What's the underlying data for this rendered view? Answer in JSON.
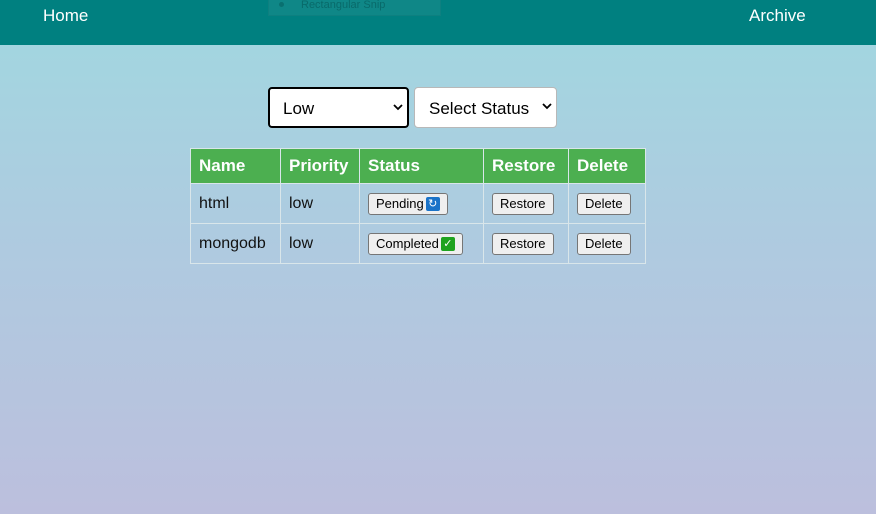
{
  "nav": {
    "home_label": "Home",
    "archive_label": "Archive"
  },
  "overlay": {
    "snip_label": "Rectangular Snip"
  },
  "filters": {
    "priority_selected": "Low",
    "status_selected": "Select Status"
  },
  "table": {
    "headers": {
      "name": "Name",
      "priority": "Priority",
      "status": "Status",
      "restore": "Restore",
      "delete": "Delete"
    },
    "rows": [
      {
        "name": "html",
        "priority": "low",
        "status": "Pending",
        "status_icon": "refresh-icon",
        "restore_label": "Restore",
        "delete_label": "Delete"
      },
      {
        "name": "mongodb",
        "priority": "low",
        "status": "Completed",
        "status_icon": "check-icon",
        "restore_label": "Restore",
        "delete_label": "Delete"
      }
    ]
  },
  "colors": {
    "navbar": "#008080",
    "table_header": "#4caf50",
    "pending_icon": "#1a73c8",
    "completed_icon": "#1fa31f"
  }
}
